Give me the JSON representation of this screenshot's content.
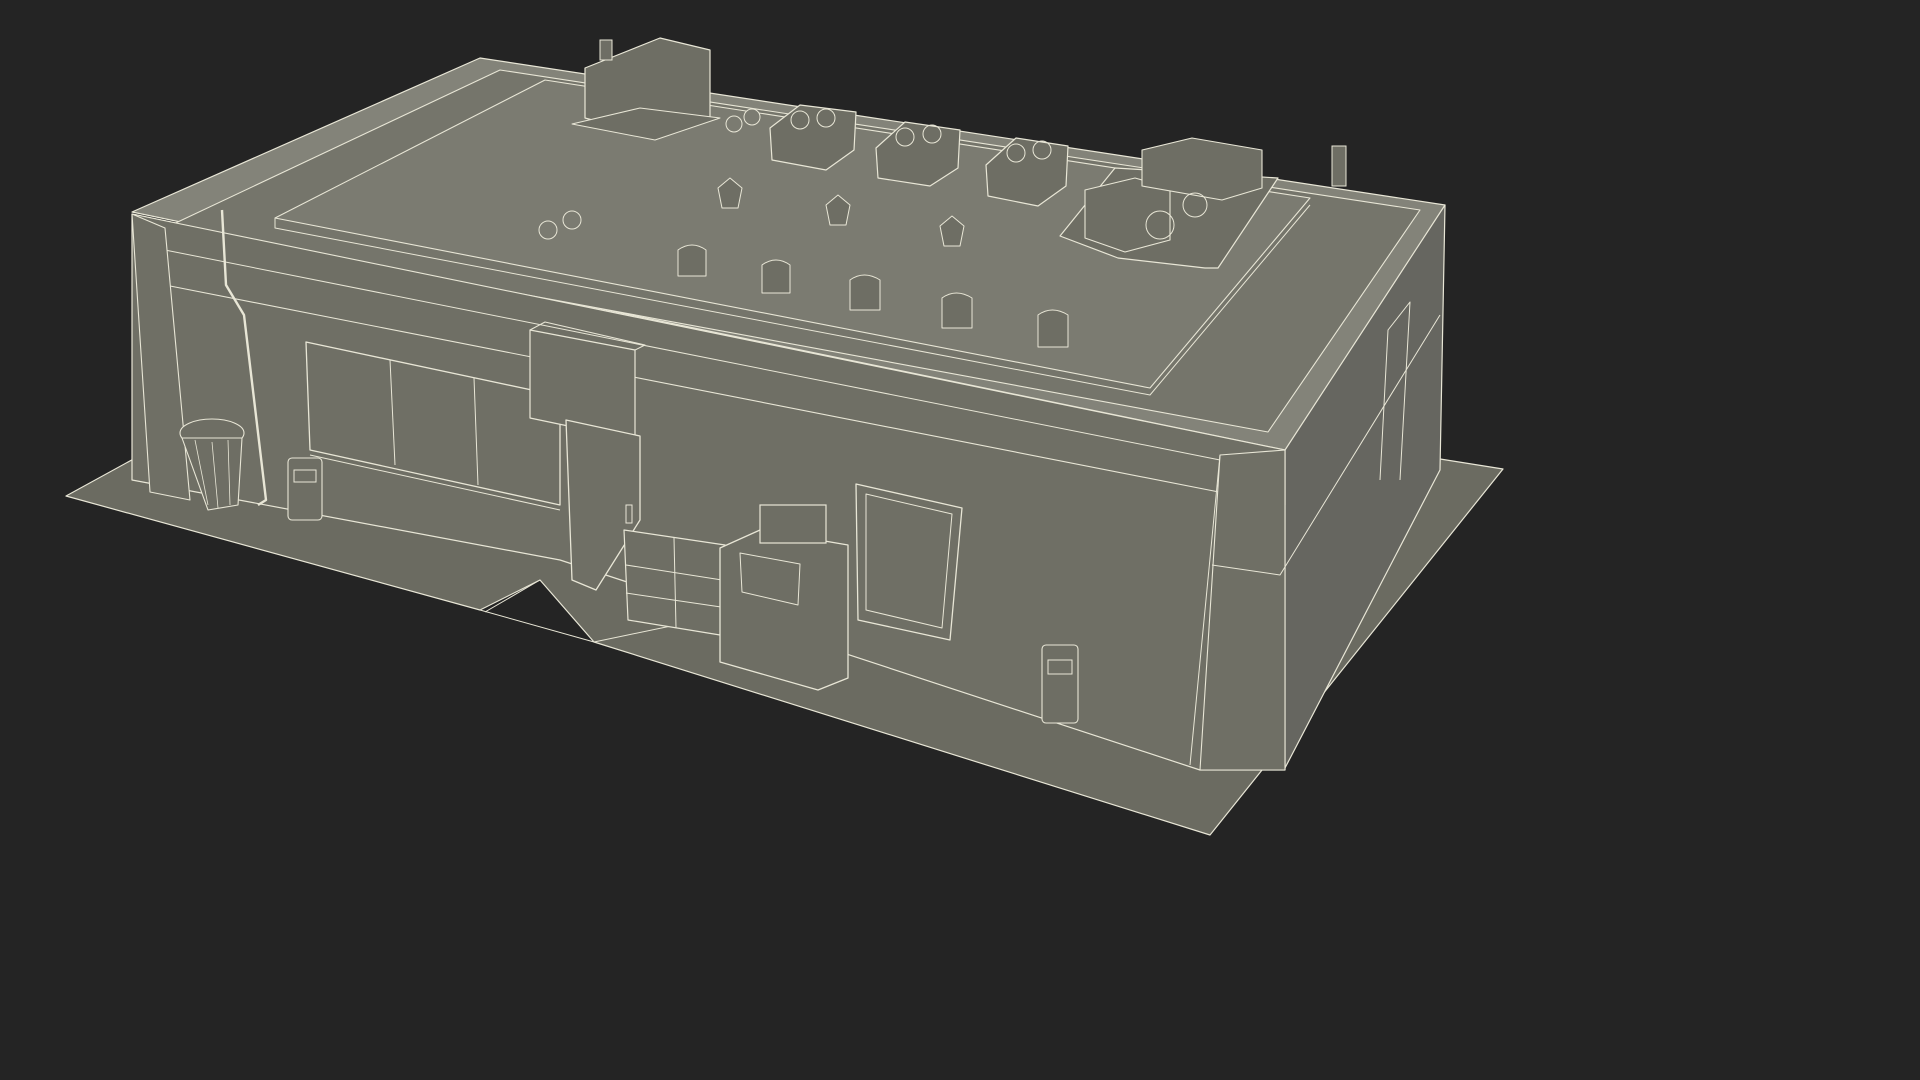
{
  "colors": {
    "background": "#242424",
    "ground": "#6b6b61",
    "wall_front": "#6f6f65",
    "wall_side": "#666660",
    "roof": "#75756b",
    "roof_raised": "#7b7b71",
    "parapet_top": "#838379",
    "unit": "#6e6e64",
    "wire": "#e8e6d6"
  }
}
